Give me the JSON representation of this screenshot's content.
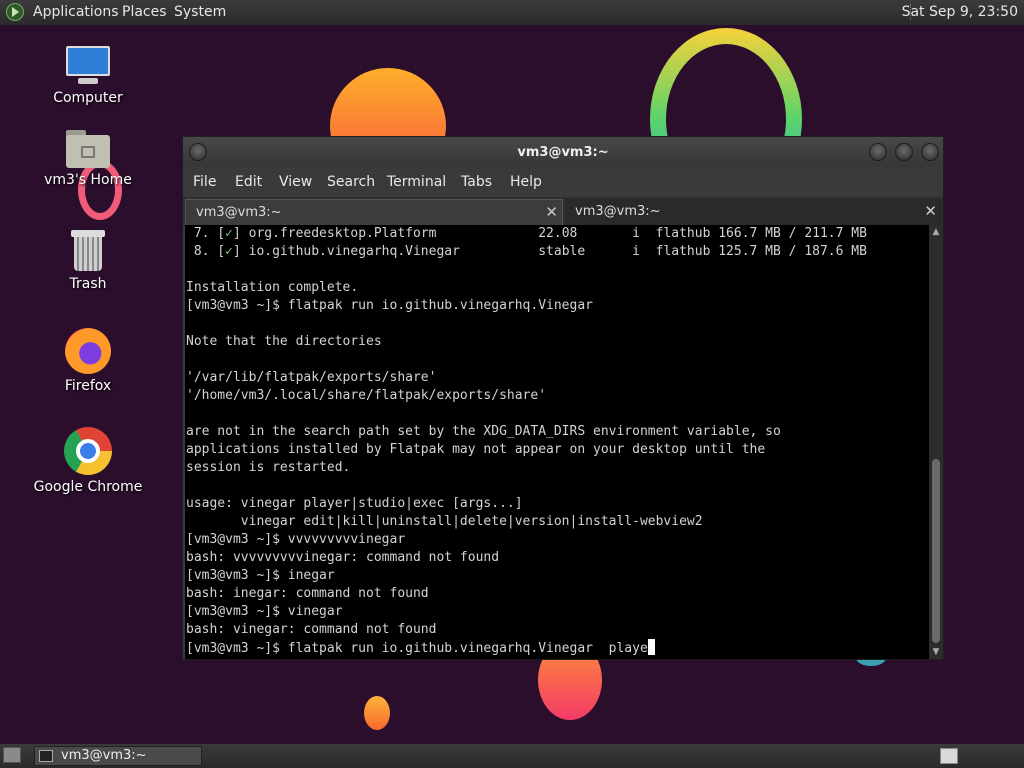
{
  "top_panel": {
    "menus": [
      "Applications",
      "Places",
      "System"
    ],
    "clock": "Sat Sep  9, 23:50"
  },
  "desktop": {
    "icons": [
      {
        "label": "Computer",
        "icon": "computer-icon"
      },
      {
        "label": "vm3's Home",
        "icon": "home-folder-icon"
      },
      {
        "label": "Trash",
        "icon": "trash-icon"
      },
      {
        "label": "Firefox",
        "icon": "firefox-icon"
      },
      {
        "label": "Google Chrome",
        "icon": "chrome-icon"
      }
    ]
  },
  "window": {
    "title": "vm3@vm3:~",
    "menu": [
      "File",
      "Edit",
      "View",
      "Search",
      "Terminal",
      "Tabs",
      "Help"
    ],
    "tabs": [
      {
        "label": "vm3@vm3:~",
        "active": true
      },
      {
        "label": "vm3@vm3:~",
        "active": false
      }
    ],
    "terminal_lines": [
      " 7. [✓] org.freedesktop.Platform             22.08       i  flathub 166.7 MB / 211.7 MB",
      " 8. [✓] io.github.vinegarhq.Vinegar          stable      i  flathub 125.7 MB / 187.6 MB",
      "",
      "Installation complete.",
      "[vm3@vm3 ~]$ flatpak run io.github.vinegarhq.Vinegar",
      "",
      "Note that the directories",
      "",
      "'/var/lib/flatpak/exports/share'",
      "'/home/vm3/.local/share/flatpak/exports/share'",
      "",
      "are not in the search path set by the XDG_DATA_DIRS environment variable, so",
      "applications installed by Flatpak may not appear on your desktop until the",
      "session is restarted.",
      "",
      "usage: vinegar player|studio|exec [args...]",
      "       vinegar edit|kill|uninstall|delete|version|install-webview2",
      "[vm3@vm3 ~]$ vvvvvvvvvinegar",
      "bash: vvvvvvvvvinegar: command not found",
      "[vm3@vm3 ~]$ inegar",
      "bash: inegar: command not found",
      "[vm3@vm3 ~]$ vinegar",
      "bash: vinegar: command not found",
      "[vm3@vm3 ~]$ flatpak run io.github.vinegarhq.Vinegar  playe"
    ]
  },
  "bottom_panel": {
    "task_label": "vm3@vm3:~"
  }
}
